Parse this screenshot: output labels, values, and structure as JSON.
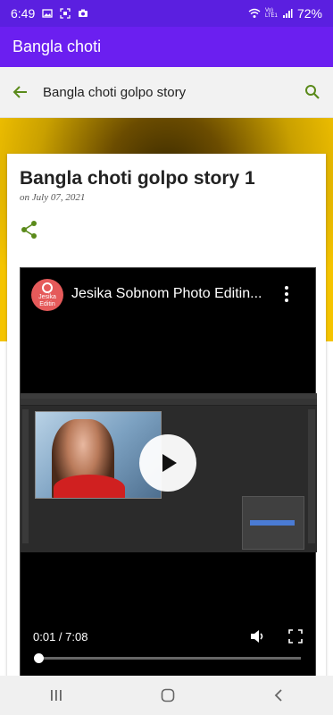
{
  "status_bar": {
    "time": "6:49",
    "icons": [
      "gallery-icon",
      "screenshot-icon",
      "camera-icon"
    ],
    "network": "Vo) LTE1",
    "battery": "72%"
  },
  "app_bar": {
    "title": "Bangla choti"
  },
  "sub_header": {
    "title": "Bangla choti golpo story"
  },
  "post": {
    "title": "Bangla choti golpo story 1",
    "date": "on July 07, 2021"
  },
  "video": {
    "channel_logo_text": "Jesika Editin",
    "title": "Jesika Sobnom Photo Editin...",
    "time": "0:01 / 7:08",
    "progress": 0.002
  },
  "colors": {
    "status_bar": "#5b1fe0",
    "app_bar": "#6b1ff0",
    "accent_green": "#5a8a1a"
  }
}
